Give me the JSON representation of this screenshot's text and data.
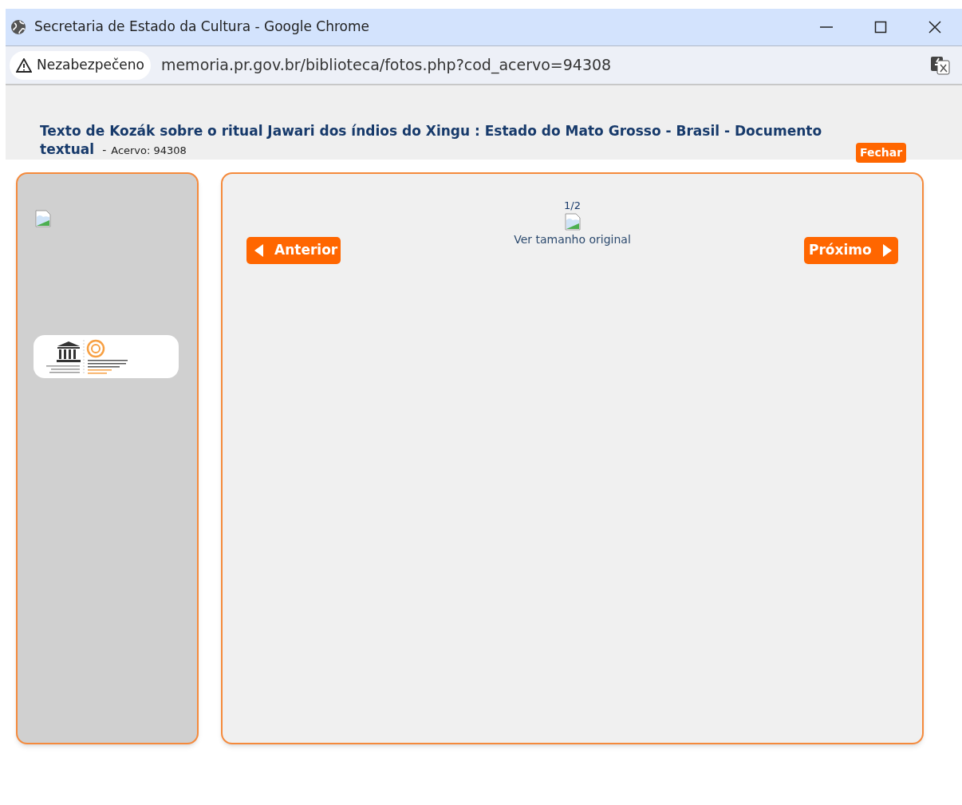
{
  "window": {
    "title": "Secretaria de Estado da Cultura - Google Chrome"
  },
  "address_bar": {
    "security": "Nezabezpečeno",
    "url": "memoria.pr.gov.br/biblioteca/fotos.php?cod_acervo=94308"
  },
  "header": {
    "title": "Texto de Kozák sobre o ritual Jawari dos índios do Xingu : Estado do Mato Grosso - Brasil - Documento textual",
    "separator": "-",
    "acervo": "Acervo: 94308",
    "close_button": "Fechar"
  },
  "viewer": {
    "counter": "1/2",
    "original_link": "Ver tamanho original",
    "prev_button": "Anterior",
    "next_button": "Próximo"
  }
}
